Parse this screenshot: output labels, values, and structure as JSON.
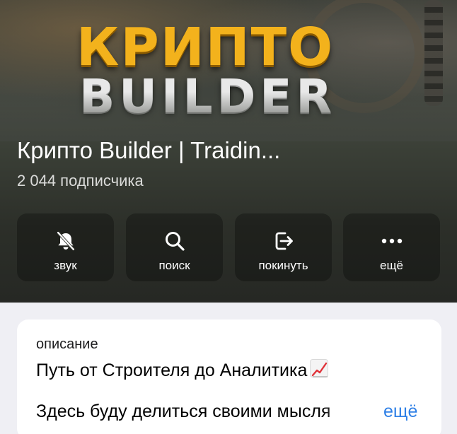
{
  "cover": {
    "logo_line1": "КРИПТО",
    "logo_line2": "BUILDER"
  },
  "channel": {
    "title": "Крипто Builder | Traidin...",
    "subscribers": "2 044 подписчика"
  },
  "actions": [
    {
      "label": "звук",
      "icon": "bell-slash-icon"
    },
    {
      "label": "поиск",
      "icon": "search-icon"
    },
    {
      "label": "покинуть",
      "icon": "leave-icon"
    },
    {
      "label": "ещё",
      "icon": "more-dots-icon"
    }
  ],
  "description": {
    "label": "описание",
    "line1": "Путь от Строителя до Аналитика",
    "line1_emoji": "chart-increasing-icon",
    "line2": "Здесь буду делиться своими мысля",
    "more": "ещё"
  },
  "colors": {
    "accent_link": "#2f80e6",
    "logo_gold": "#f3b21c"
  }
}
